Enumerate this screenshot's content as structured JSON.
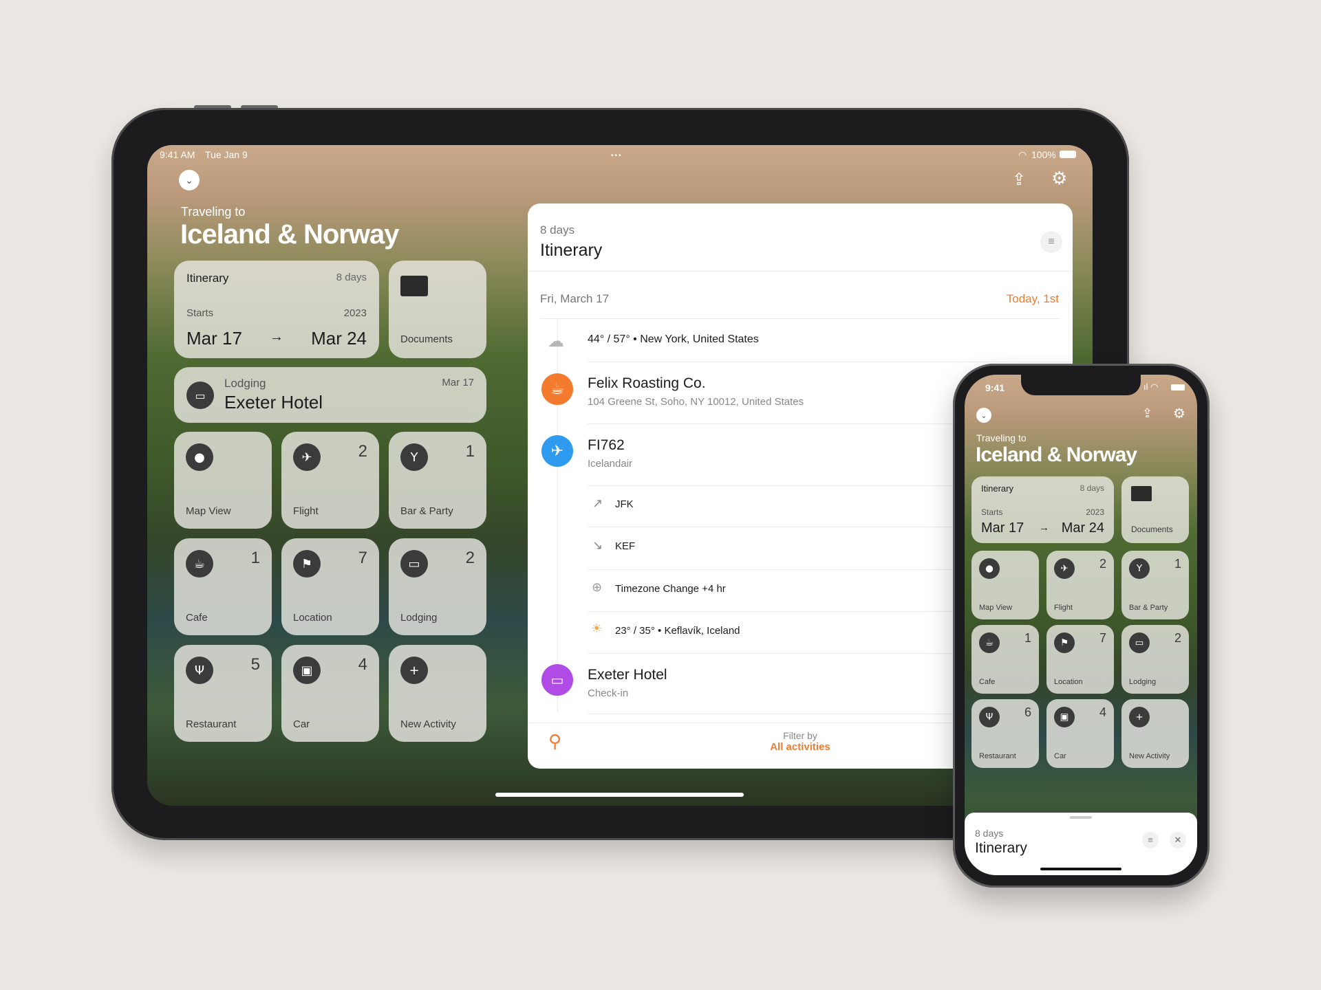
{
  "ipad": {
    "status": {
      "time": "9:41 AM",
      "date": "Tue Jan 9",
      "battery": "100%"
    },
    "header": {
      "subtitle": "Traveling to",
      "title": "Iceland & Norway"
    },
    "itinerary_card": {
      "label": "Itinerary",
      "days": "8 days",
      "starts_label": "Starts",
      "year": "2023",
      "start": "Mar 17",
      "arrow": "→",
      "end": "Mar 24"
    },
    "documents": {
      "label": "Documents"
    },
    "lodging_card": {
      "label": "Lodging",
      "name": "Exeter Hotel",
      "date": "Mar 17"
    },
    "tiles": [
      {
        "label": "Map View",
        "count": "",
        "icon": "map-pin"
      },
      {
        "label": "Flight",
        "count": "2",
        "icon": "airplane"
      },
      {
        "label": "Bar & Party",
        "count": "1",
        "icon": "cocktail"
      },
      {
        "label": "Cafe",
        "count": "1",
        "icon": "coffee-cup"
      },
      {
        "label": "Location",
        "count": "7",
        "icon": "flag"
      },
      {
        "label": "Lodging",
        "count": "2",
        "icon": "bed"
      },
      {
        "label": "Restaurant",
        "count": "5",
        "icon": "fork-knife"
      },
      {
        "label": "Car",
        "count": "4",
        "icon": "car"
      },
      {
        "label": "New Activity",
        "count": "",
        "icon": "plus"
      }
    ],
    "panel": {
      "days": "8 days",
      "title": "Itinerary",
      "date": "Fri, March 17",
      "today": "Today, 1st",
      "weather1": "44° / 57° • New York, United States",
      "cafe": {
        "name": "Felix Roasting Co.",
        "address": "104 Greene St, Soho, NY 10012, United States"
      },
      "flight": {
        "name": "FI762",
        "airline": "Icelandair",
        "from": "JFK",
        "to": "KEF",
        "timezone": "Timezone Change +4 hr",
        "weather": "23° / 35° • Keflavík, Iceland"
      },
      "hotel": {
        "name": "Exeter Hotel",
        "sub": "Check-in"
      },
      "filter_label": "Filter by",
      "filter_value": "All activities"
    }
  },
  "iphone": {
    "status": {
      "time": "9:41"
    },
    "header": {
      "subtitle": "Traveling to",
      "title": "Iceland & Norway"
    },
    "itinerary_card": {
      "label": "Itinerary",
      "days": "8 days",
      "starts_label": "Starts",
      "year": "2023",
      "start": "Mar 17",
      "arrow": "→",
      "end": "Mar 24"
    },
    "documents": {
      "label": "Documents"
    },
    "tiles": [
      {
        "label": "Map View",
        "count": "",
        "icon": "map-pin"
      },
      {
        "label": "Flight",
        "count": "2",
        "icon": "airplane"
      },
      {
        "label": "Bar & Party",
        "count": "1",
        "icon": "cocktail"
      },
      {
        "label": "Cafe",
        "count": "1",
        "icon": "coffee-cup"
      },
      {
        "label": "Location",
        "count": "7",
        "icon": "flag"
      },
      {
        "label": "Lodging",
        "count": "2",
        "icon": "bed"
      },
      {
        "label": "Restaurant",
        "count": "6",
        "icon": "fork-knife"
      },
      {
        "label": "Car",
        "count": "4",
        "icon": "car"
      },
      {
        "label": "New Activity",
        "count": "",
        "icon": "plus"
      }
    ],
    "sheet": {
      "days": "8 days",
      "title": "Itinerary"
    }
  },
  "colors": {
    "accent": "#f07b2f",
    "cafe": "#f47a2e",
    "flight": "#2f9bf0",
    "hotel": "#b14be6"
  }
}
